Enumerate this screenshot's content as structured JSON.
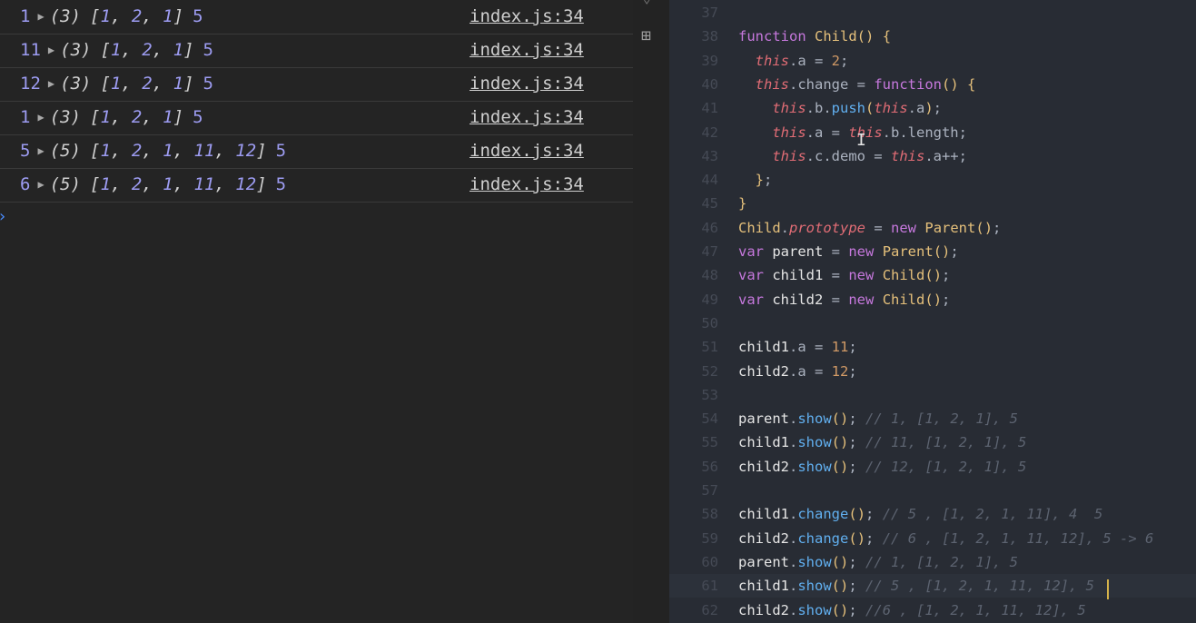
{
  "console": {
    "rows": [
      {
        "first": "1",
        "len": "(3)",
        "arr": [
          "1",
          "2",
          "1"
        ],
        "last": "5",
        "source": "index.js:34"
      },
      {
        "first": "11",
        "len": "(3)",
        "arr": [
          "1",
          "2",
          "1"
        ],
        "last": "5",
        "source": "index.js:34"
      },
      {
        "first": "12",
        "len": "(3)",
        "arr": [
          "1",
          "2",
          "1"
        ],
        "last": "5",
        "source": "index.js:34"
      },
      {
        "first": "1",
        "len": "(3)",
        "arr": [
          "1",
          "2",
          "1"
        ],
        "last": "5",
        "source": "index.js:34"
      },
      {
        "first": "5",
        "len": "(5)",
        "arr": [
          "1",
          "2",
          "1",
          "11",
          "12"
        ],
        "last": "5",
        "source": "index.js:34"
      },
      {
        "first": "6",
        "len": "(5)",
        "arr": [
          "1",
          "2",
          "1",
          "11",
          "12"
        ],
        "last": "5",
        "source": "index.js:34"
      }
    ],
    "prompt": "›",
    "expand_icon": "disclosure-triangle-icon"
  },
  "sidebar": {
    "icon": "extensions-icon",
    "icon_glyph": "⊞"
  },
  "editor": {
    "active_line": "61",
    "lines": [
      {
        "n": "37",
        "text": ""
      },
      {
        "n": "38",
        "text": "function Child() {"
      },
      {
        "n": "39",
        "text": "  this.a = 2;"
      },
      {
        "n": "40",
        "text": "  this.change = function() {"
      },
      {
        "n": "41",
        "text": "    this.b.push(this.a);"
      },
      {
        "n": "42",
        "text": "    this.a = this.b.length;"
      },
      {
        "n": "43",
        "text": "    this.c.demo = this.a++;"
      },
      {
        "n": "44",
        "text": "  };"
      },
      {
        "n": "45",
        "text": "}"
      },
      {
        "n": "46",
        "text": "Child.prototype = new Parent();"
      },
      {
        "n": "47",
        "text": "var parent = new Parent();"
      },
      {
        "n": "48",
        "text": "var child1 = new Child();"
      },
      {
        "n": "49",
        "text": "var child2 = new Child();"
      },
      {
        "n": "50",
        "text": ""
      },
      {
        "n": "51",
        "text": "child1.a = 11;"
      },
      {
        "n": "52",
        "text": "child2.a = 12;"
      },
      {
        "n": "53",
        "text": ""
      },
      {
        "n": "54",
        "text": "parent.show(); // 1, [1, 2, 1], 5"
      },
      {
        "n": "55",
        "text": "child1.show(); // 11, [1, 2, 1], 5"
      },
      {
        "n": "56",
        "text": "child2.show(); // 12, [1, 2, 1], 5"
      },
      {
        "n": "57",
        "text": ""
      },
      {
        "n": "58",
        "text": "child1.change(); // 5 , [1, 2, 1, 11], 4  5"
      },
      {
        "n": "59",
        "text": "child2.change(); // 6 , [1, 2, 1, 11, 12], 5 -> 6"
      },
      {
        "n": "60",
        "text": "parent.show(); // 1, [1, 2, 1], 5"
      },
      {
        "n": "61",
        "text": "child1.show(); // 5 , [1, 2, 1, 11, 12], 5"
      },
      {
        "n": "62",
        "text": "child2.show(); //6 , [1, 2, 1, 11, 12], 5"
      }
    ]
  },
  "colors": {
    "console_bg": "#242424",
    "editor_bg": "#282c34",
    "number": "#9d9cf2",
    "keyword": "#c678dd",
    "function": "#61afef",
    "class": "#e5c07b",
    "this": "#e06c75",
    "numeric_literal": "#d19a66",
    "comment": "#5c6370"
  }
}
